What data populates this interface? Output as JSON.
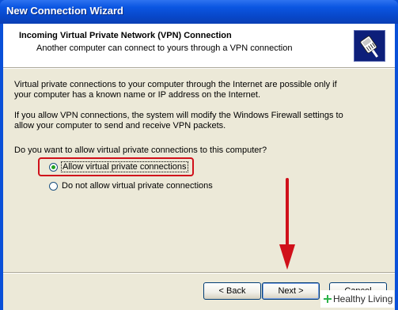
{
  "window": {
    "title": "New Connection Wizard"
  },
  "header": {
    "title": "Incoming Virtual Private Network (VPN) Connection",
    "subtitle": "Another computer can connect to yours through a VPN connection",
    "icon": "network-cable-icon"
  },
  "body": {
    "paragraph1_line1": "Virtual private connections to your computer through the Internet are possible only if",
    "paragraph1_line2": "your computer has a known name or IP address on the Internet.",
    "paragraph2_line1": "If you allow VPN connections, the system will modify the Windows Firewall settings to",
    "paragraph2_line2": "allow your computer to send and receive VPN packets.",
    "question": "Do you want to allow virtual private connections to this computer?",
    "options": [
      {
        "label": "Allow virtual private connections",
        "selected": true
      },
      {
        "label": "Do not allow virtual private connections",
        "selected": false
      }
    ]
  },
  "buttons": {
    "back": "< Back",
    "next": "Next >",
    "cancel": "Cancel"
  },
  "watermark": {
    "text": "Healthy Living"
  },
  "colors": {
    "titlebar": "#0a50d8",
    "dialog_bg": "#ece9d8",
    "highlight": "#d0101a",
    "arrow": "#d0101a"
  }
}
